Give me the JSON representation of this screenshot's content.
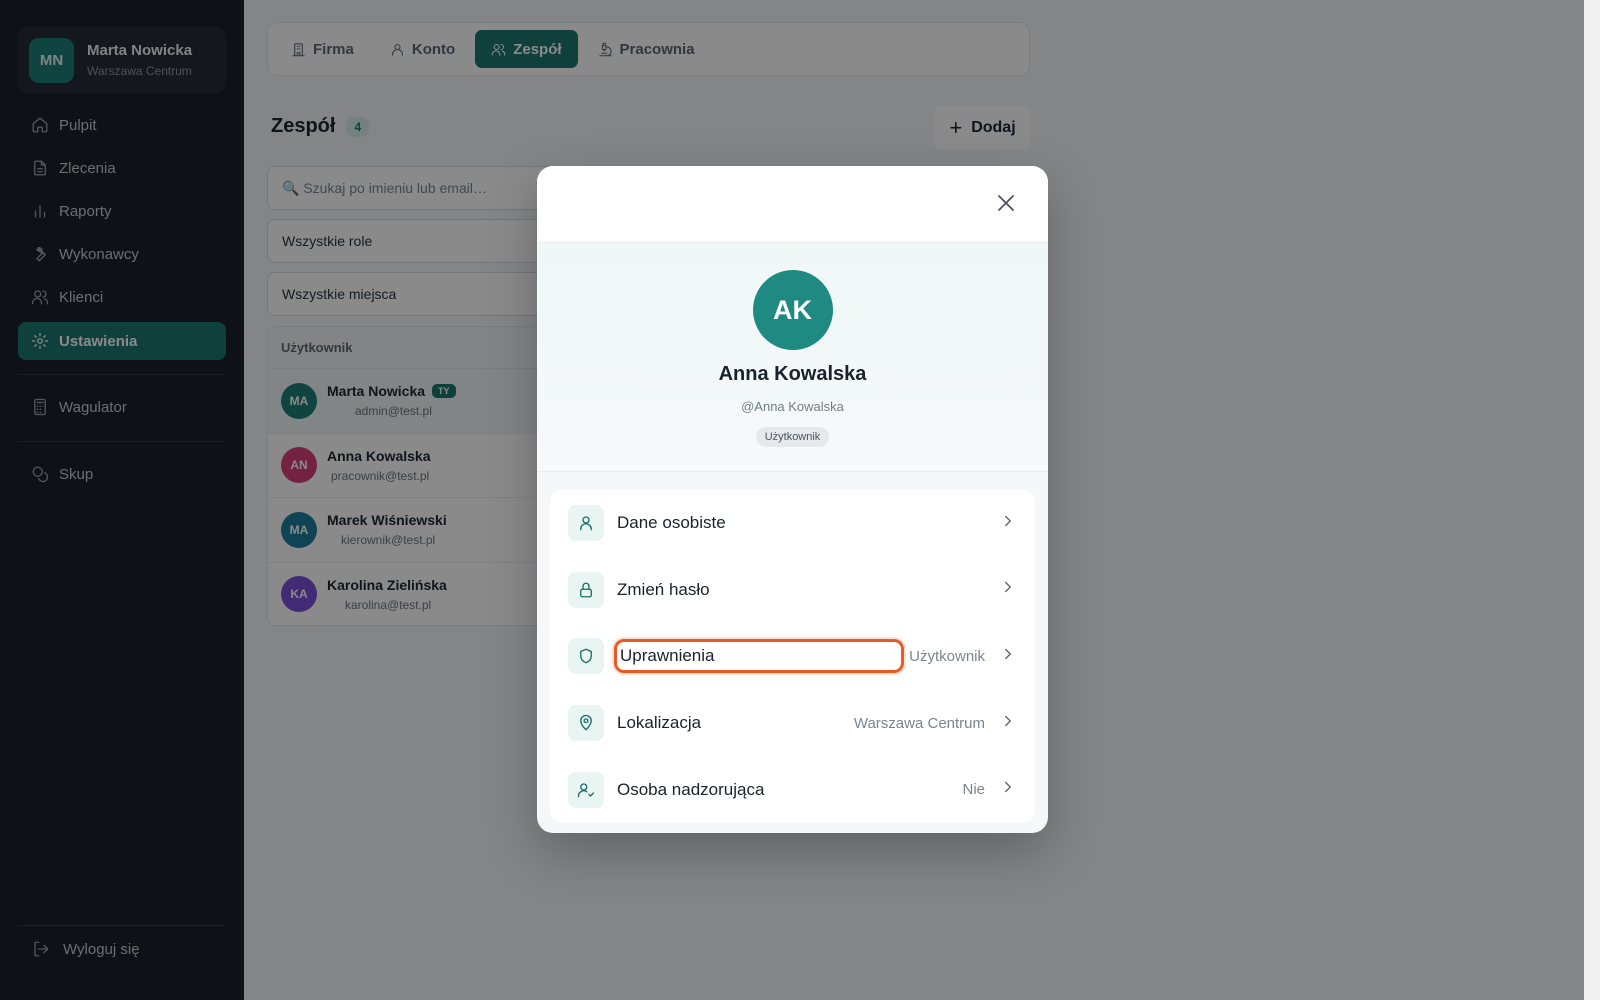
{
  "sidebar": {
    "user": {
      "initials": "MN",
      "name": "Marta Nowicka",
      "location": "Warszawa Centrum"
    },
    "items": [
      {
        "label": "Pulpit",
        "icon": "home-icon"
      },
      {
        "label": "Zlecenia",
        "icon": "document-icon"
      },
      {
        "label": "Raporty",
        "icon": "bar-chart-icon"
      },
      {
        "label": "Wykonawcy",
        "icon": "wrench-icon"
      },
      {
        "label": "Klienci",
        "icon": "users-icon"
      },
      {
        "label": "Ustawienia",
        "icon": "gear-icon",
        "active": true
      }
    ],
    "extra_items": [
      {
        "label": "Wagulator",
        "icon": "calculator-icon"
      },
      {
        "label": "Skup",
        "icon": "coins-icon"
      }
    ],
    "logout_label": "Wyloguj się"
  },
  "tabs": [
    {
      "label": "Firma",
      "icon": "building-icon"
    },
    {
      "label": "Konto",
      "icon": "user-icon"
    },
    {
      "label": "Zespół",
      "icon": "users-icon",
      "active": true
    },
    {
      "label": "Pracownia",
      "icon": "microscope-icon"
    }
  ],
  "team": {
    "title": "Zespół",
    "count": "4",
    "add_label": "Dodaj",
    "search_placeholder": "🔍 Szukaj po imieniu lub email…",
    "role_filter": "Wszystkie role",
    "place_filter": "Wszystkie miejsca",
    "table_header": "Użytkownik",
    "rows": [
      {
        "initials": "MA",
        "name": "Marta Nowicka",
        "email": "admin@test.pl",
        "badge": "TY",
        "color": "#1f7f78"
      },
      {
        "initials": "AN",
        "name": "Anna Kowalska",
        "email": "pracownik@test.pl",
        "color": "#d6407a"
      },
      {
        "initials": "MA",
        "name": "Marek Wiśniewski",
        "email": "kierownik@test.pl",
        "color": "#1a7f9a"
      },
      {
        "initials": "KA",
        "name": "Karolina Zielińska",
        "email": "karolina@test.pl",
        "color": "#7b4fd6"
      }
    ]
  },
  "modal": {
    "avatar_initials": "AK",
    "name": "Anna Kowalska",
    "handle": "@Anna Kowalska",
    "role_badge": "Użytkownik",
    "menu": [
      {
        "label": "Dane osobiste",
        "value": "",
        "icon": "user-icon"
      },
      {
        "label": "Zmień hasło",
        "value": "",
        "icon": "lock-icon"
      },
      {
        "label": "Uprawnienia",
        "value": "Użytkownik",
        "icon": "shield-icon",
        "focused": true
      },
      {
        "label": "Lokalizacja",
        "value": "Warszawa Centrum",
        "icon": "map-pin-icon"
      },
      {
        "label": "Osoba nadzorująca",
        "value": "Nie",
        "icon": "user-check-icon"
      }
    ]
  },
  "colors": {
    "accent": "#1d766f",
    "focus_ring": "#ea5a24",
    "sidebar_bg": "#1b222b"
  }
}
